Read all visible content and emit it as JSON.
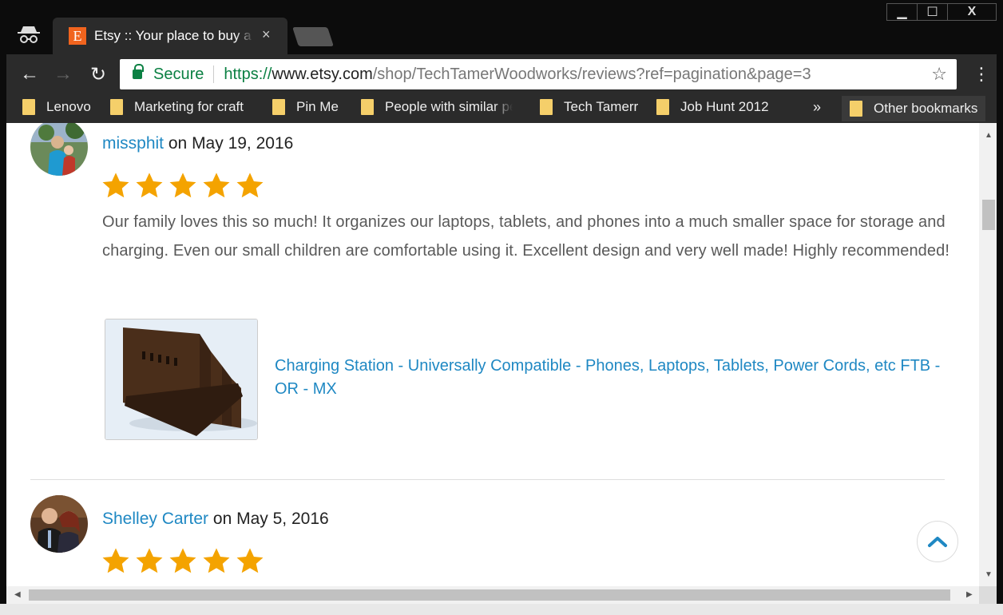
{
  "window": {
    "minimize": "▁",
    "maximize": "☐",
    "close": "X"
  },
  "tab": {
    "favicon": "E",
    "title": "Etsy :: Your place to buy a",
    "close": "×"
  },
  "toolbar": {
    "back": "←",
    "forward": "→",
    "reload": "↻",
    "security_label": "Secure",
    "url_scheme": "https://",
    "url_host": "www.etsy.com",
    "url_path": "/shop/TechTamerWoodworks/reviews?ref=pagination&page=3",
    "bookmark_star": "☆",
    "menu": "⋮"
  },
  "bookmarks": {
    "items": [
      {
        "label": "Lenovo"
      },
      {
        "label": "Marketing for craft"
      },
      {
        "label": "Pin Me"
      },
      {
        "label": "People with similar pe"
      },
      {
        "label": "Tech Tamerr"
      },
      {
        "label": "Job Hunt 2012"
      }
    ],
    "overflow": "»",
    "other": "Other bookmarks"
  },
  "reviews": [
    {
      "reviewer": "missphit",
      "date_text": "on May 19, 2016",
      "rating": 5,
      "text": "Our family loves this so much! It organizes our laptops, tablets, and phones into a much smaller space for storage and charging. Even our small children are comfortable using it. Excellent design and very well made! Highly recommended!",
      "product_title": "Charging Station - Universally Compatible - Phones, Laptops, Tablets, Power Cords, etc FTB - OR - MX"
    },
    {
      "reviewer": "Shelley Carter",
      "date_text": "on May 5, 2016",
      "rating": 5
    }
  ],
  "colors": {
    "link": "#1f88c3",
    "star": "#f4a300",
    "secure": "#0b8043",
    "etsy_orange": "#f1641e"
  },
  "icons": [
    "incognito-icon",
    "etsy-favicon",
    "back-arrow-icon",
    "forward-arrow-icon",
    "reload-icon",
    "lock-icon",
    "bookmark-star-icon",
    "menu-dots-icon",
    "folder-icon",
    "star-rating-icon",
    "chevron-up-icon"
  ]
}
